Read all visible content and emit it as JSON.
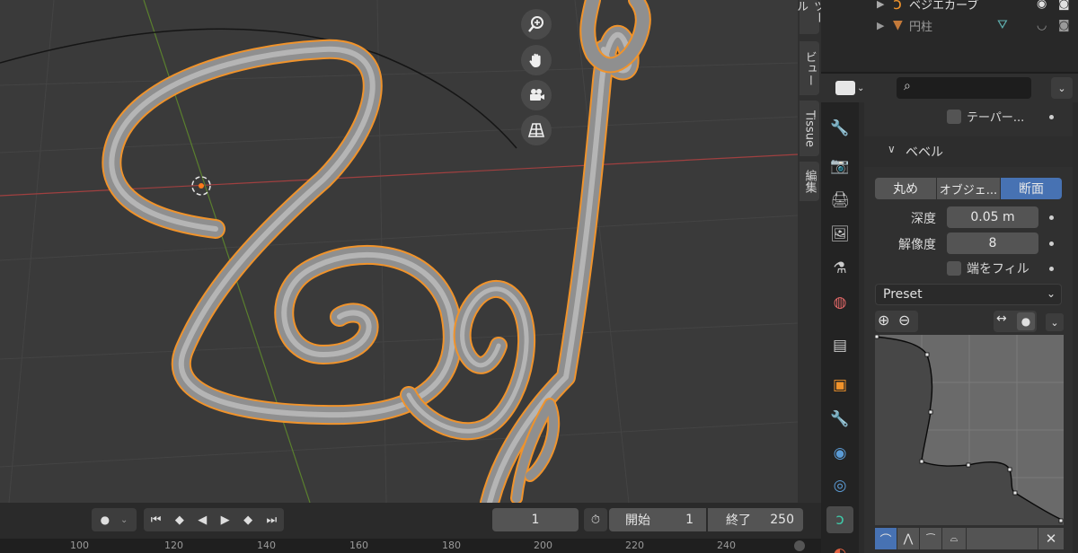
{
  "vtabs": [
    "ツール",
    "ビュー",
    "Tissue",
    "編集"
  ],
  "outliner": {
    "rows": [
      {
        "label": "ベジエカーブ"
      },
      {
        "label": "円柱"
      }
    ]
  },
  "props": {
    "search_placeholder": "",
    "taper_label": "テーパー...",
    "bevel_section": "ベベル",
    "mode_buttons": [
      "丸め",
      "オブジェ...",
      "断面"
    ],
    "active_mode": "断面",
    "depth_label": "深度",
    "depth_value": "0.05 m",
    "resolution_label": "解像度",
    "resolution_value": "8",
    "fill_caps_label": "端をフィル",
    "preset_label": "Preset"
  },
  "timeline": {
    "current_frame": "1",
    "start_label": "開始",
    "start_value": "1",
    "end_label": "終了",
    "end_value": "250",
    "ruler_ticks": [
      "100",
      "120",
      "140",
      "160",
      "180",
      "200",
      "220",
      "240"
    ]
  },
  "colors": {
    "accent": "#4772b3",
    "selection_outline": "#f0932b",
    "curve_tube": "#9c9c9c"
  }
}
